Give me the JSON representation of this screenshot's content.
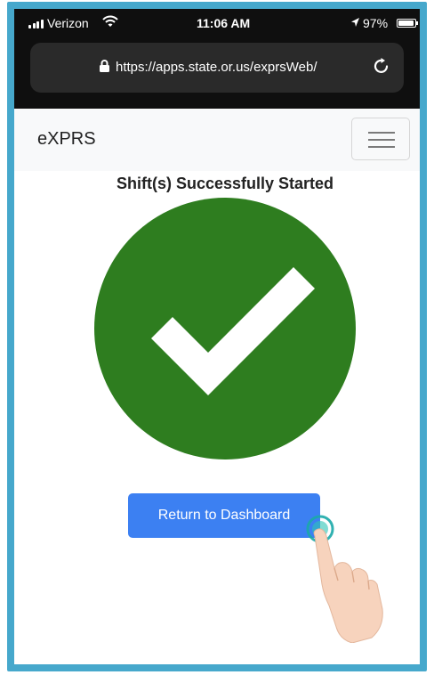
{
  "status_bar": {
    "carrier": "Verizon",
    "time": "11:06 AM",
    "battery": "97%",
    "icons": [
      "signal-icon",
      "wifi-icon",
      "location-arrow-icon",
      "battery-icon"
    ]
  },
  "browser": {
    "url": "https://apps.state.or.us/exprsWeb/",
    "icons": [
      "lock-icon",
      "reload-icon"
    ]
  },
  "navbar": {
    "brand": "eXPRS",
    "menu_icon": "hamburger-menu-icon"
  },
  "main": {
    "headline": "Shift(s) Successfully Started",
    "success_icon": "check-circle-icon",
    "button_label": "Return to Dashboard"
  },
  "colors": {
    "success_green": "#2e7d1f",
    "button_blue": "#3c80f2",
    "frame_border": "#46a8cc"
  }
}
